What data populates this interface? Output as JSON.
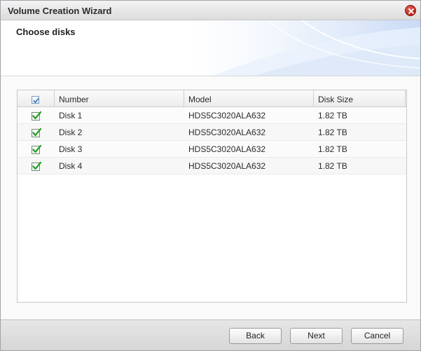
{
  "window": {
    "title": "Volume Creation Wizard"
  },
  "header": {
    "title": "Choose disks"
  },
  "grid": {
    "columns": [
      "Number",
      "Model",
      "Disk Size"
    ],
    "rows": [
      {
        "number": "Disk 1",
        "model": "HDS5C3020ALA632",
        "size": "1.82 TB",
        "checked": true
      },
      {
        "number": "Disk 2",
        "model": "HDS5C3020ALA632",
        "size": "1.82 TB",
        "checked": true
      },
      {
        "number": "Disk 3",
        "model": "HDS5C3020ALA632",
        "size": "1.82 TB",
        "checked": true
      },
      {
        "number": "Disk 4",
        "model": "HDS5C3020ALA632",
        "size": "1.82 TB",
        "checked": true
      }
    ]
  },
  "footer": {
    "back_label": "Back",
    "next_label": "Next",
    "cancel_label": "Cancel"
  },
  "colors": {
    "check_green": "#2e9e2e",
    "header_accent": "#c9daf6",
    "close_red": "#c0392b"
  }
}
